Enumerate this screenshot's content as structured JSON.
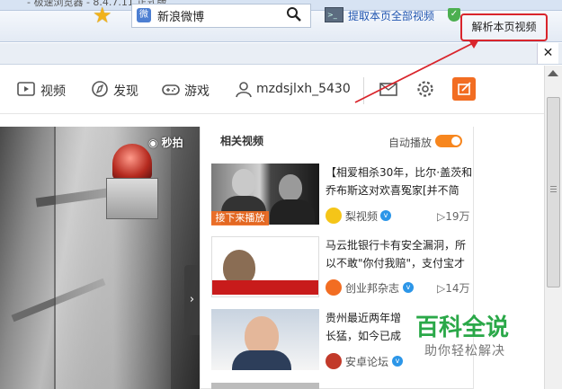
{
  "colors": {
    "accent_orange": "#f26d22",
    "highlight_red": "#d9252c",
    "link_blue": "#2055b0",
    "watermark_green": "#2aa848"
  },
  "titlebar": {
    "title": "- 极速浏览器 - 8.4.7.11 正式版"
  },
  "toolbar": {
    "bookmark_icon": "star-icon",
    "address_text": "新浪微博",
    "extract_all_videos": "提取本页全部视频",
    "parse_video": "解析本页视频"
  },
  "nav": {
    "video": "视频",
    "discover": "发现",
    "games": "游戏",
    "username": "mzdsjlxh_5430"
  },
  "player": {
    "brand": "秒拍"
  },
  "related": {
    "title": "相关视频",
    "autoplay_label": "自动播放",
    "autoplay_on": true,
    "next_label": "接下来播放",
    "items": [
      {
        "title": "【相爱相杀30年，比尔·盖茨和乔布斯这对欢喜冤家[并不简",
        "source": "梨视频",
        "plays": "19万",
        "verified": true
      },
      {
        "title": "马云批银行卡有安全漏洞，所以不敢\"你付我赔\"，支付宝才",
        "source": "创业邦杂志",
        "plays": "14万",
        "verified": true
      },
      {
        "title": "贵州最近两年增长猛，如今已成为",
        "source": "安卓论坛",
        "plays": "",
        "verified": true
      }
    ]
  },
  "watermark": {
    "main": "百科全说",
    "sub": "助你轻松解决"
  }
}
